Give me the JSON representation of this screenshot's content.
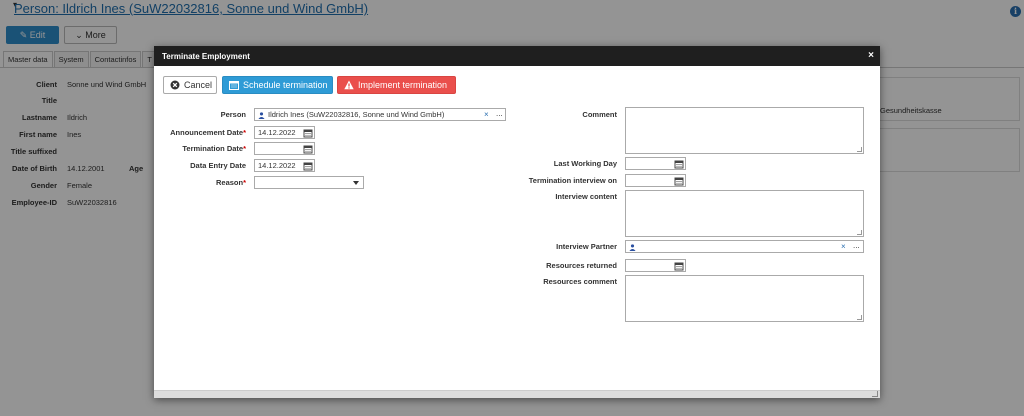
{
  "page": {
    "title": "Person: Ildrich Ines (SuW22032816, Sonne und Wind GmbH)",
    "edit_label": "Edit",
    "more_label": "More",
    "tabs": [
      "Master data",
      "System",
      "Contactinfos",
      "T"
    ],
    "fields": {
      "client_label": "Client",
      "client_value": "Sonne und Wind GmbH",
      "title_label": "Title",
      "lastname_label": "Lastname",
      "lastname_value": "Ildrich",
      "firstname_label": "First name",
      "firstname_value": "Ines",
      "title_suffixed_label": "Title suffixed",
      "dob_label": "Date of Birth",
      "dob_value": "14.12.2001",
      "age_label": "Age",
      "gender_label": "Gender",
      "gender_value": "Female",
      "employee_id_label": "Employee-ID",
      "employee_id_value": "SuW22032816"
    },
    "right_panel_text": "Gesundheitskasse"
  },
  "modal": {
    "title": "Terminate Employment",
    "close_label": "×",
    "buttons": {
      "cancel": "Cancel",
      "schedule": "Schedule termination",
      "implement": "Implement termination"
    },
    "left": {
      "person_label": "Person",
      "person_value": "Ildrich Ines (SuW22032816, Sonne und Wind GmbH)",
      "announcement_label": "Announcement Date",
      "announcement_value": "14.12.2022",
      "termination_label": "Termination Date",
      "termination_value": "",
      "data_entry_label": "Data Entry Date",
      "data_entry_value": "14.12.2022",
      "reason_label": "Reason",
      "reason_value": ""
    },
    "right": {
      "comment_label": "Comment",
      "last_working_day_label": "Last Working Day",
      "interview_on_label": "Termination interview on",
      "interview_content_label": "Interview content",
      "interview_partner_label": "Interview Partner",
      "resources_returned_label": "Resources returned",
      "resources_comment_label": "Resources comment"
    },
    "required_mark": "*",
    "clear_symbol": "×",
    "lookup_symbol": "..."
  },
  "colors": {
    "schedule": "#2e9bd6",
    "implement": "#ea4f4c",
    "header": "#1f1f1f",
    "link": "#1f6fae"
  }
}
